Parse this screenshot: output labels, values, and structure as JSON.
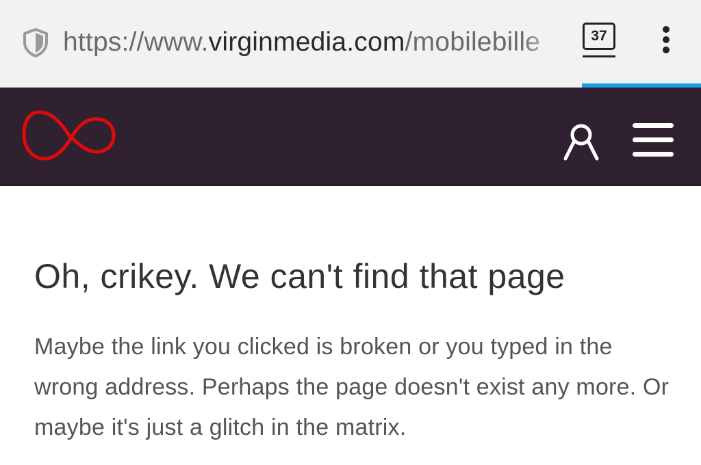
{
  "browser": {
    "url_prefix": "https://www.",
    "url_host": "virginmedia.com",
    "url_path": "/mobilebille",
    "tab_count": "37",
    "accent_color": "#1ea0e6"
  },
  "header": {
    "background_color": "#2f2130",
    "logo_color": "#e10a0a",
    "icons": [
      "virgin-media-logo",
      "account-icon",
      "menu-icon"
    ]
  },
  "content": {
    "title": "Oh, crikey. We can't find that page",
    "message": "Maybe the link you clicked is broken or you typed in the wrong address. Perhaps the page doesn't exist any more. Or maybe it's just a glitch in the matrix."
  }
}
